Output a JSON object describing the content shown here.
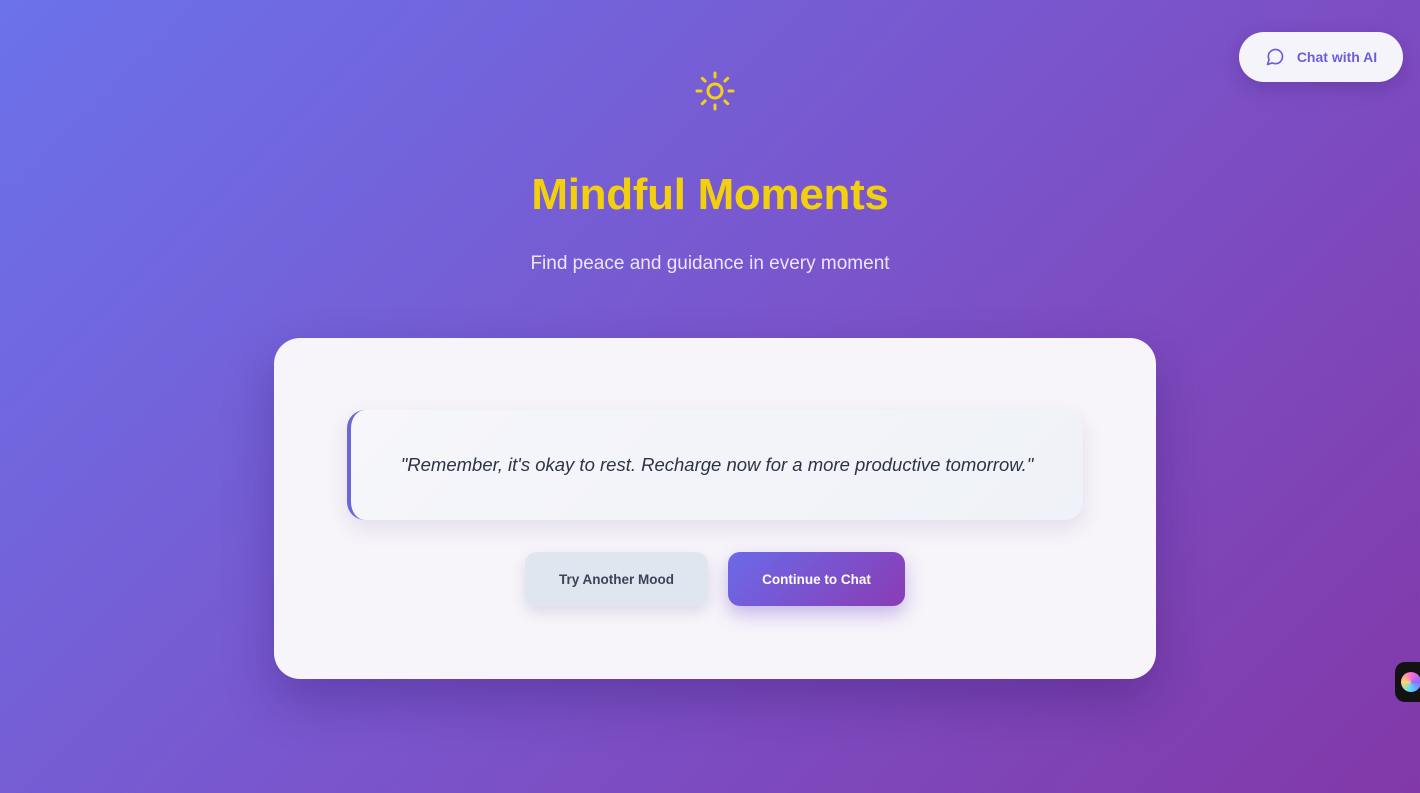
{
  "header": {
    "chat_button_label": "Chat with AI",
    "chat_icon": "message-circle-icon"
  },
  "hero": {
    "icon": "sun-icon",
    "title": "Mindful Moments",
    "subtitle": "Find peace and guidance in every moment"
  },
  "card": {
    "quote": "\"Remember, it's okay to rest. Recharge now for a more productive tomorrow.\"",
    "secondary_button_label": "Try Another Mood",
    "primary_button_label": "Continue to Chat"
  },
  "floating_widget": {
    "icon": "assistant-orb-icon"
  },
  "colors": {
    "title": "#f2d00d",
    "sun": "#f5cf1a",
    "accent": "#6a5fd9",
    "quote_border": "#6b67d6"
  }
}
